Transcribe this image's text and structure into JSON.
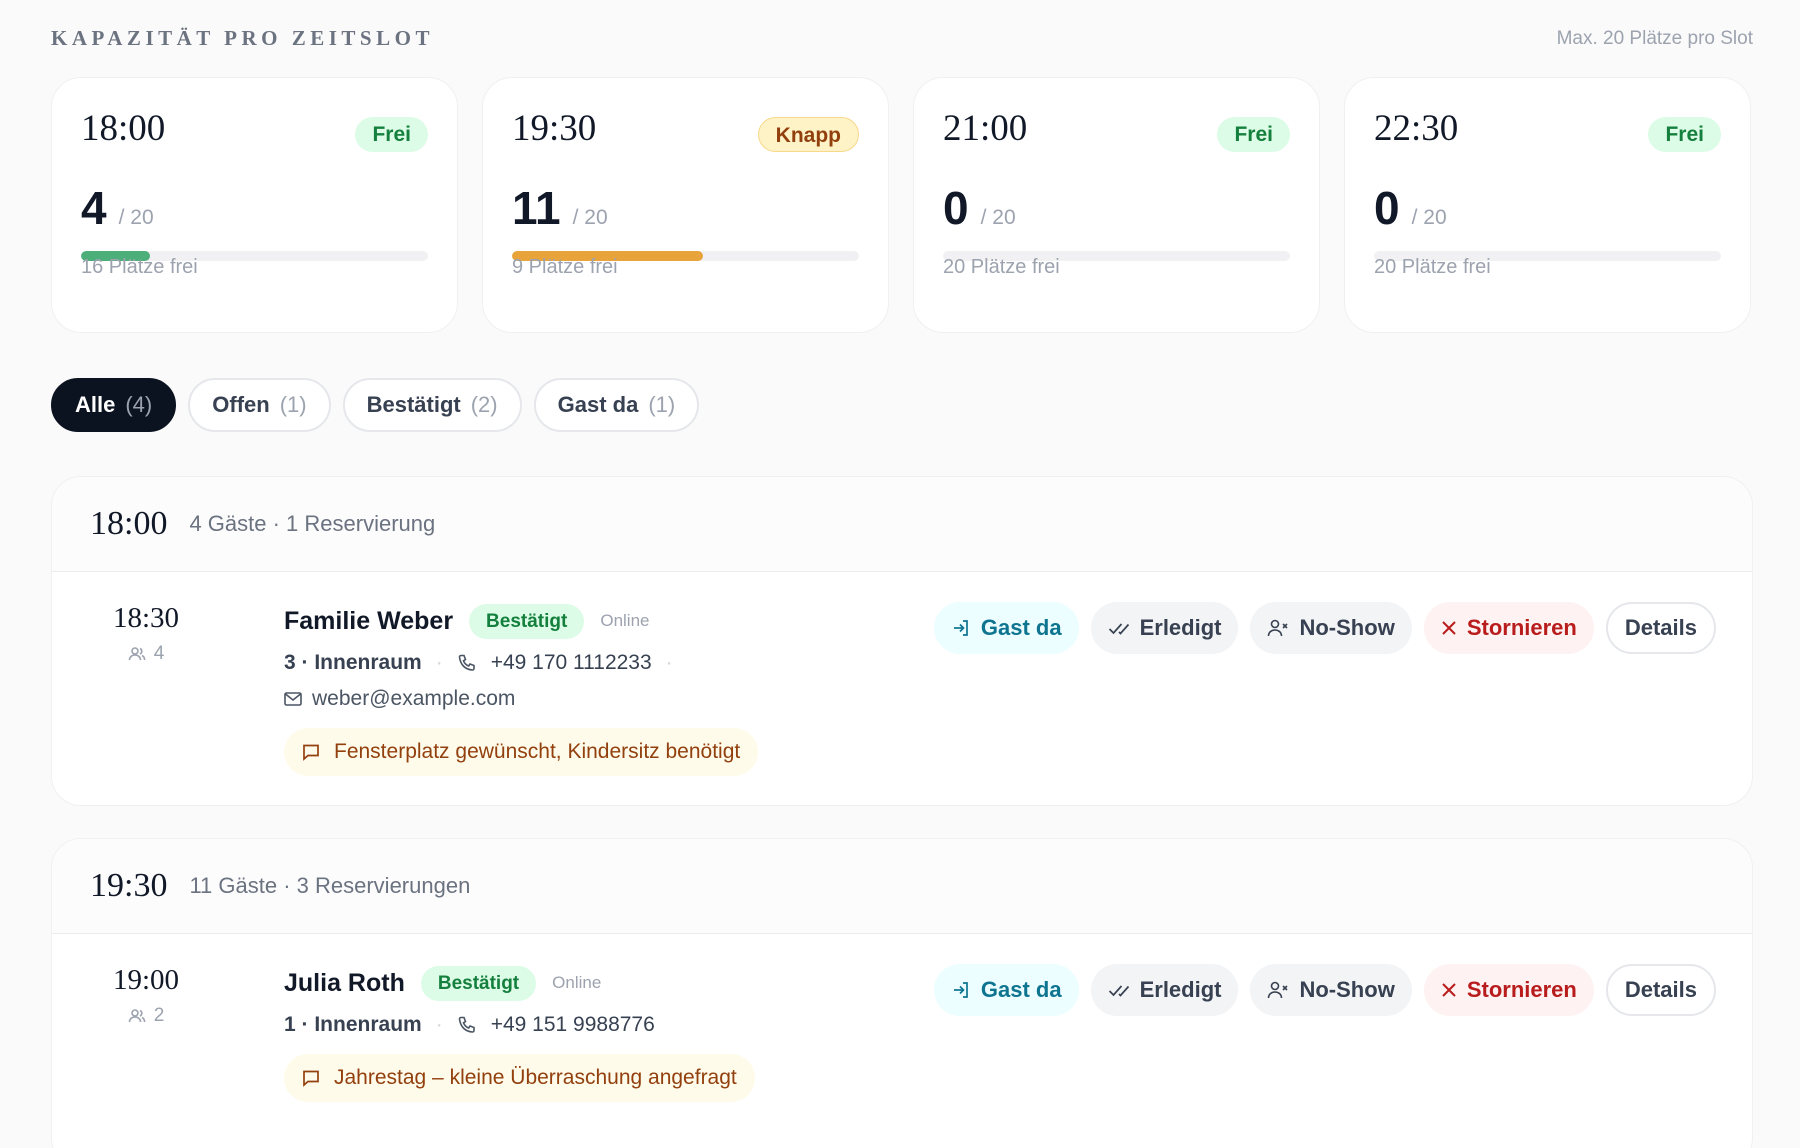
{
  "capacity": {
    "title": "KAPAZITÄT PRO ZEITSLOT",
    "max_label": "Max. 20 Plätze pro Slot",
    "slots": [
      {
        "time": "18:00",
        "badge": "Frei",
        "booked": "4",
        "max": "/ 20",
        "free_label": "16 Plätze frei",
        "fill": 0.2,
        "bar_color": "#4caf7a",
        "status": "free"
      },
      {
        "time": "19:30",
        "badge": "Knapp",
        "booked": "11",
        "max": "/ 20",
        "free_label": "9 Plätze frei",
        "fill": 0.55,
        "bar_color": "#e8a33a",
        "status": "tight"
      },
      {
        "time": "21:00",
        "badge": "Frei",
        "booked": "0",
        "max": "/ 20",
        "free_label": "20 Plätze frei",
        "fill": 0,
        "bar_color": "#4caf7a",
        "status": "free"
      },
      {
        "time": "22:30",
        "badge": "Frei",
        "booked": "0",
        "max": "/ 20",
        "free_label": "20 Plätze frei",
        "fill": 0,
        "bar_color": "#4caf7a",
        "status": "free"
      }
    ]
  },
  "filters": [
    {
      "label": "Alle",
      "count": "(4)",
      "active": true
    },
    {
      "label": "Offen",
      "count": "(1)",
      "active": false
    },
    {
      "label": "Bestätigt",
      "count": "(2)",
      "active": false
    },
    {
      "label": "Gast da",
      "count": "(1)",
      "active": false
    }
  ],
  "groups": [
    {
      "time": "18:00",
      "meta": "4 Gäste · 1 Reservierung",
      "reservations": [
        {
          "time": "18:30",
          "guests": "4",
          "name": "Familie Weber",
          "status": "Bestätigt",
          "source": "Online",
          "table": "3 · Innenraum",
          "phone": "+49 170 1112233",
          "email": "weber@example.com",
          "note": "Fensterplatz gewünscht, Kindersitz benötigt"
        }
      ]
    },
    {
      "time": "19:30",
      "meta": "11 Gäste · 3 Reservierungen",
      "reservations": [
        {
          "time": "19:00",
          "guests": "2",
          "name": "Julia Roth",
          "status": "Bestätigt",
          "source": "Online",
          "table": "1 · Innenraum",
          "phone": "+49 151 9988776",
          "note": "Jahrestag – kleine Überraschung angefragt"
        }
      ]
    }
  ],
  "actions": {
    "checkin": "Gast da",
    "done": "Erledigt",
    "noshow": "No-Show",
    "cancel": "Stornieren",
    "details": "Details"
  }
}
